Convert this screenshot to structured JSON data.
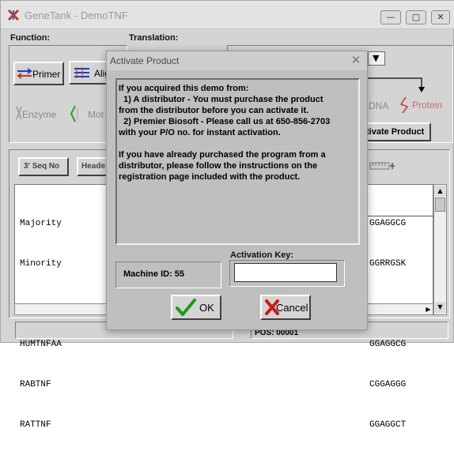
{
  "window": {
    "title": "GeneTank - DemoTNF",
    "minimize": "—",
    "maximize": "▢",
    "close": "✕"
  },
  "labels": {
    "function": "Function:",
    "translation": "Translation:"
  },
  "toolbar": {
    "primer": "Primer",
    "align": "Alig",
    "enzyme": "Enzyme",
    "motif": "Mot",
    "dna": "DNA",
    "protein": "Protein",
    "activate_product": "tivate Product"
  },
  "tabs": {
    "seq_no": "3' Seq No",
    "header": "Heade"
  },
  "sequences": {
    "names": [
      "Majority",
      "Minority",
      "",
      "HUMTNFAA",
      "RABTNF",
      "RATTNF"
    ],
    "tails": [
      "GGAGGCG",
      "GGRRGSK",
      "",
      "GGAGGCG",
      "CGGAGGG",
      "GGAGGCT"
    ]
  },
  "status": {
    "pos": "POS:  00001"
  },
  "dialog": {
    "title": "Activate Product",
    "close": "✕",
    "message_lines": [
      "If you acquired this demo from:",
      "  1) A distributor - You must purchase the product",
      "from the distributor before you can activate it.",
      "  2) Premier Biosoft - Please call us at 650-856-2703",
      "with your P/O no. for instant activation.",
      "",
      "If you have already purchased the program from a",
      "distributor, please follow the instructions on the",
      "registration page included with the product."
    ],
    "machine_id": "Machine ID: 55",
    "activation_key_label": "Activation Key:",
    "activation_key_value": "",
    "ok": "OK",
    "cancel": "Cancel"
  }
}
